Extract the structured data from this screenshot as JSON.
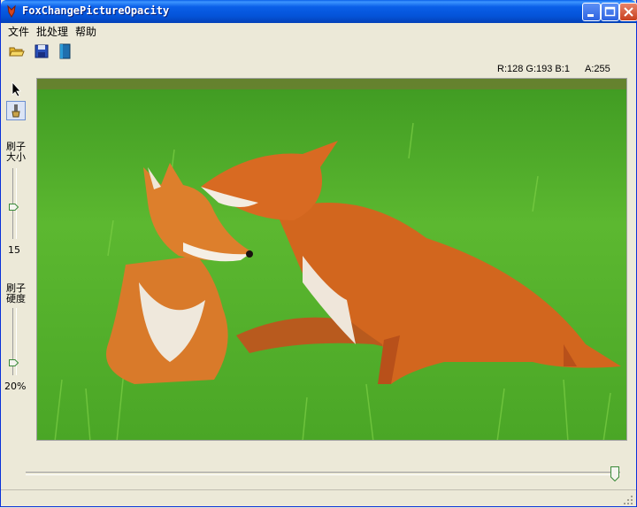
{
  "window": {
    "title": "FoxChangePictureOpacity"
  },
  "menu": {
    "file": "文件",
    "batch": "批处理",
    "help": "帮助"
  },
  "toolbar": {
    "open": "open-folder-icon",
    "save": "save-icon",
    "book": "book-icon"
  },
  "readout": {
    "rgb": "R:128 G:193 B:1",
    "alpha": "A:255"
  },
  "tools": {
    "pointer": "pointer-icon",
    "brush": "brush-icon"
  },
  "brush_size": {
    "label_line1": "刷子",
    "label_line2": "大小",
    "value": "15"
  },
  "brush_hardness": {
    "label_line1": "刷子",
    "label_line2": "硬度",
    "value": "20%"
  },
  "opacity_slider": {
    "level": 1.0
  },
  "colors": {
    "accent": "#0a5fe8",
    "grass": "#4fa82a",
    "fox": "#d2661e"
  }
}
